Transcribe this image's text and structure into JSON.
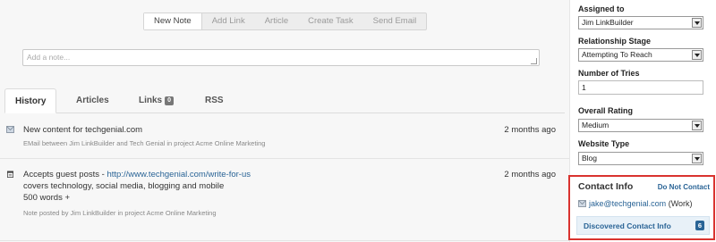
{
  "actions": [
    "New Note",
    "Add Link",
    "Article",
    "Create Task",
    "Send Email"
  ],
  "note": {
    "placeholder": "Add a note..."
  },
  "tabs": {
    "history": "History",
    "articles": "Articles",
    "links": "Links",
    "links_count": "0",
    "rss": "RSS"
  },
  "history": [
    {
      "icon": "envelope-icon",
      "title": "New content for techgenial.com",
      "time": "2 months ago",
      "sub": "EMail between Jim LinkBuilder and Tech Genial in project Acme Online Marketing"
    },
    {
      "icon": "note-icon",
      "title_prefix": "Accepts guest posts - ",
      "title_link": "http://www.techgenial.com/write-for-us",
      "time": "2 months ago",
      "line1": "covers technology, social media, blogging and mobile",
      "line2": "500 words +",
      "sub": "Note posted by Jim LinkBuilder in project Acme Online Marketing"
    }
  ],
  "sidebar": {
    "assigned_label": "Assigned to",
    "assigned_value": "Jim LinkBuilder",
    "stage_label": "Relationship Stage",
    "stage_value": "Attempting To Reach",
    "tries_label": "Number of Tries",
    "tries_value": "1",
    "rating_label": "Overall Rating",
    "rating_value": "Medium",
    "type_label": "Website Type",
    "type_value": "Blog"
  },
  "contact": {
    "title": "Contact Info",
    "dnc": "Do Not Contact",
    "email": "jake@techgenial.com",
    "email_kind": "(Work)",
    "discovered": "Discovered Contact Info",
    "discovered_count": "6"
  },
  "colors": {
    "accent": "#2a6496",
    "highlight_border": "#d9332f"
  }
}
